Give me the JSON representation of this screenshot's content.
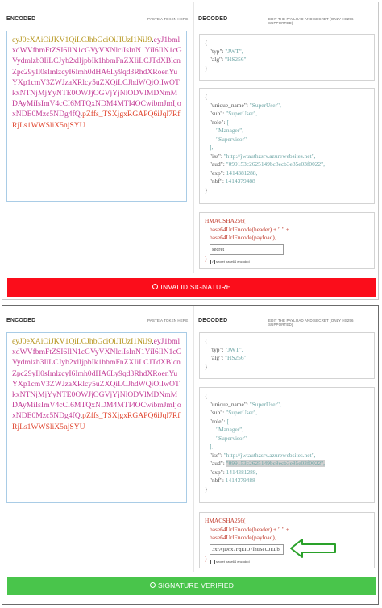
{
  "encoded_label": "ENCODED",
  "encoded_hint": "PASTE A TOKEN HERE",
  "decoded_label": "DECODED",
  "decoded_hint": "EDIT THE PAYLOAD AND SECRET (ONLY HS256 SUPPORTED)",
  "token": {
    "header": "eyJ0eXAiOiJKV1QiLCJhbGciOiJIUzI1NiJ9",
    "dot1": ".",
    "payload": "eyJ1bmlxdWVfbmFtZSI6IlN1cGVyVXNlciIsInN1YiI6IlN1cGVydmlzb3IiLCJyb2xlIjpbIk1hbmFnZXIiLCJTdXBlcnZpc29yIl0sImlzcyI6Imh0dHA6Ly9qd3RhdXRoenYuYXp1cmV3ZWJzaXRlcy5uZXQiLCJhdWQiOiIwOTkxNTNjMjYyNTE0OWJjOGVjYjNlODVlMDNmMDAyMiIsImV4cCI6MTQxNDM4MTI4OCwibmJmIjoxNDE0Mzc5NDg4fQ",
    "dot2": ".",
    "signature": "pZffs_TSXjgxRGAPQ6iJql7RfRjLs1WWSliX5njSYU"
  },
  "header_json": {
    "open": "{",
    "lines": [
      {
        "key": "\"typ\": ",
        "val": "\"JWT\","
      },
      {
        "key": "\"alg\": ",
        "val": "\"HS256\""
      }
    ],
    "close": "}"
  },
  "payload_json": {
    "open": "{",
    "lines": [
      {
        "key": "\"unique_name\": ",
        "val": "\"SuperUser\","
      },
      {
        "key": "\"sub\": ",
        "val": "\"SuperUser\","
      },
      {
        "key": "\"role\": ",
        "val": "["
      },
      {
        "key": "   ",
        "val": "\"Manager\","
      },
      {
        "key": "   ",
        "val": "\"Supervisor\""
      },
      {
        "key": "",
        "val": "],"
      },
      {
        "key": "\"iss\": ",
        "val": "\"http://jwtauthzsrv.azurewebsites.net\","
      },
      {
        "key": "\"aud\": ",
        "val": "\"099153c2625149bc8ecb3e85e03f0022\","
      },
      {
        "key": "\"exp\": ",
        "val": "1414381288,"
      },
      {
        "key": "\"nbf\": ",
        "val": "1414379488"
      }
    ],
    "close": "}"
  },
  "signature_code": {
    "line1": "HMACSHA256(",
    "line2": "base64UrlEncode(header) + \".\" +",
    "line3": "base64UrlEncode(payload),",
    "close": ")"
  },
  "secret_top": "secret",
  "secret_bottom": "3xrAjDox7FqEIO7lhuSeUJELb",
  "checkbox_label": "secret base64 encoded",
  "invalid_label": "INVALID SIGNATURE",
  "verified_label": "SIGNATURE VERIFIED",
  "colors": {
    "invalid": "#fb0d1b",
    "verified": "#49c54b",
    "token_header": "#b5941b",
    "token_payload": "#c33c96",
    "token_signature": "#e0452f",
    "arrow": "#2aa12a"
  }
}
